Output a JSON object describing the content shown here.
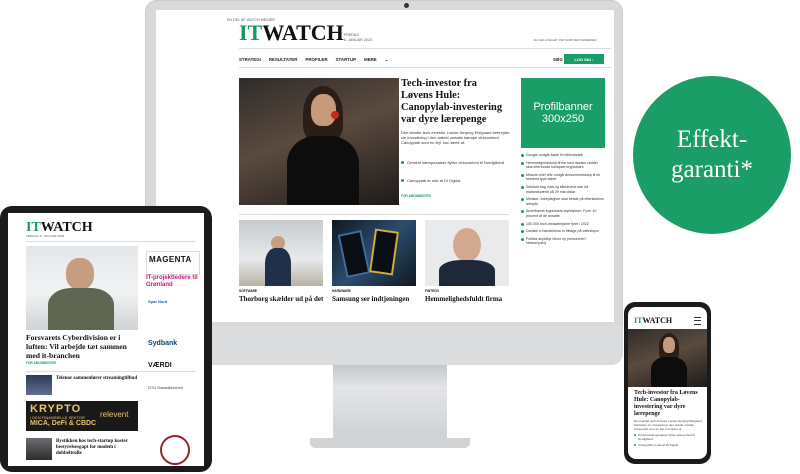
{
  "badge": {
    "line1": "Effekt-",
    "line2": "garanti*"
  },
  "desktop": {
    "topline": "EN DEL AF WATCH MEDIER",
    "logo_it": "IT",
    "logo_watch": "WATCH",
    "date_line1": "FREDAG",
    "date_line2": "6. JANUAR 2023",
    "login_note": "DU ER LOGGET IND SOM WATCHMEDIER",
    "nav": [
      "STRATEGI",
      "RESULTATER",
      "PROFILER",
      "STARTUP",
      "MERE"
    ],
    "search_label": "SØG",
    "login_button": "LOG IND",
    "lead_headline": "Tech-investor fra Løvens Hule: Canopylab-investering var dyre lærepenge",
    "lead_summary": "Den kendte tech-investor Louise Herping Ellegaard bebrejder sin investering i den stærkt omtalte kæmpe virksomhed Canopylab som en fejl, hun lærte af.",
    "lead_bullets": [
      "Omstrid kæmpesatser flytter virksomhed til Nordjylland",
      "Canopylab er ude af DI Digital"
    ],
    "lead_section": "FOR ABONNENTER",
    "banner_line1": "Profilbanner",
    "banner_line2": "300x250",
    "sidebar_list": [
      "Google undgår bøde til millionbeløb",
      "Hemmelighedsfuldt firma med danske rødder skal efterforske kollapset kryptobørs",
      "Miracle-chef ville undgå virksomhedsstop til én bestemt type kaber",
      "Selskab bag chat-og billedrobot kan nå markedsværdi på 29 mia dollar",
      "Minister: Arbejdsgiver skal betale på efterskolens arbejde",
      "Amerikansk kryptobørs styrtdykker: Fyrer 40 procent af de ansatte",
      "150.000 tech-medarbejdere fyret i 2022",
      "Danske e-handelshus er tilbage på vækstspor",
      "Politisk skyldbyr bliver ny pressechef i Netcompany"
    ],
    "cards": [
      {
        "cat": "SOFTWARE",
        "headline": "Thorborg skælder ud på det"
      },
      {
        "cat": "HARDWARE",
        "headline": "Samsung ser indtjeningen"
      },
      {
        "cat": "FINTECH",
        "headline": "Hemmelighedsfuldt firma"
      }
    ]
  },
  "tablet": {
    "logo_it": "IT",
    "logo_watch": "WATCH",
    "date": "FREDAG 6. JANUAR 2023",
    "headline": "Forsvarets Cyberdivision er i luften: Vil arbejde tæt sammen med it-branchen",
    "section": "FOR ABONNENTER",
    "ad_magenta": "MAGENTA",
    "ad_magenta_sub": "IT-projektledere til Grønland",
    "jobs": [
      "Spar Nord",
      "Sydbank",
      "VÆRDI",
      "DTU Datasikkerhed"
    ],
    "story2": "Telenor sammenfører streamingtilbud",
    "story3": "Bystikken hos tech-startup koster bestyrelsesgapt for modem i dobbeltrolle",
    "ad_crypto": "KRYPTO",
    "ad_crypto_sub": "I DEN FINANSIELLE SEKTOR",
    "ad_crypto_sub2": "MICA, DeFi & CBDC",
    "ad_relevent": "relevent"
  },
  "phone": {
    "logo_it": "IT",
    "logo_watch": "WATCH",
    "headline": "Tech-investor fra Løvens Hule: Canopylab-investering var dyre lærepenge",
    "summary": "Den kendte tech-investor Louise Herping Ellegaard bebrejder sin investering i den stærkt omtalte Canopylab som en fejl, hun lærte af.",
    "bullets": [
      "Omstrid kæmpesatser flytter virksomhed til Nordjylland",
      "Canopylab er ude af DI Digital"
    ]
  },
  "colors": {
    "brand_green": "#1a9d66",
    "device_dark": "#1b1b1b",
    "monitor_silver": "#d7d9db"
  }
}
